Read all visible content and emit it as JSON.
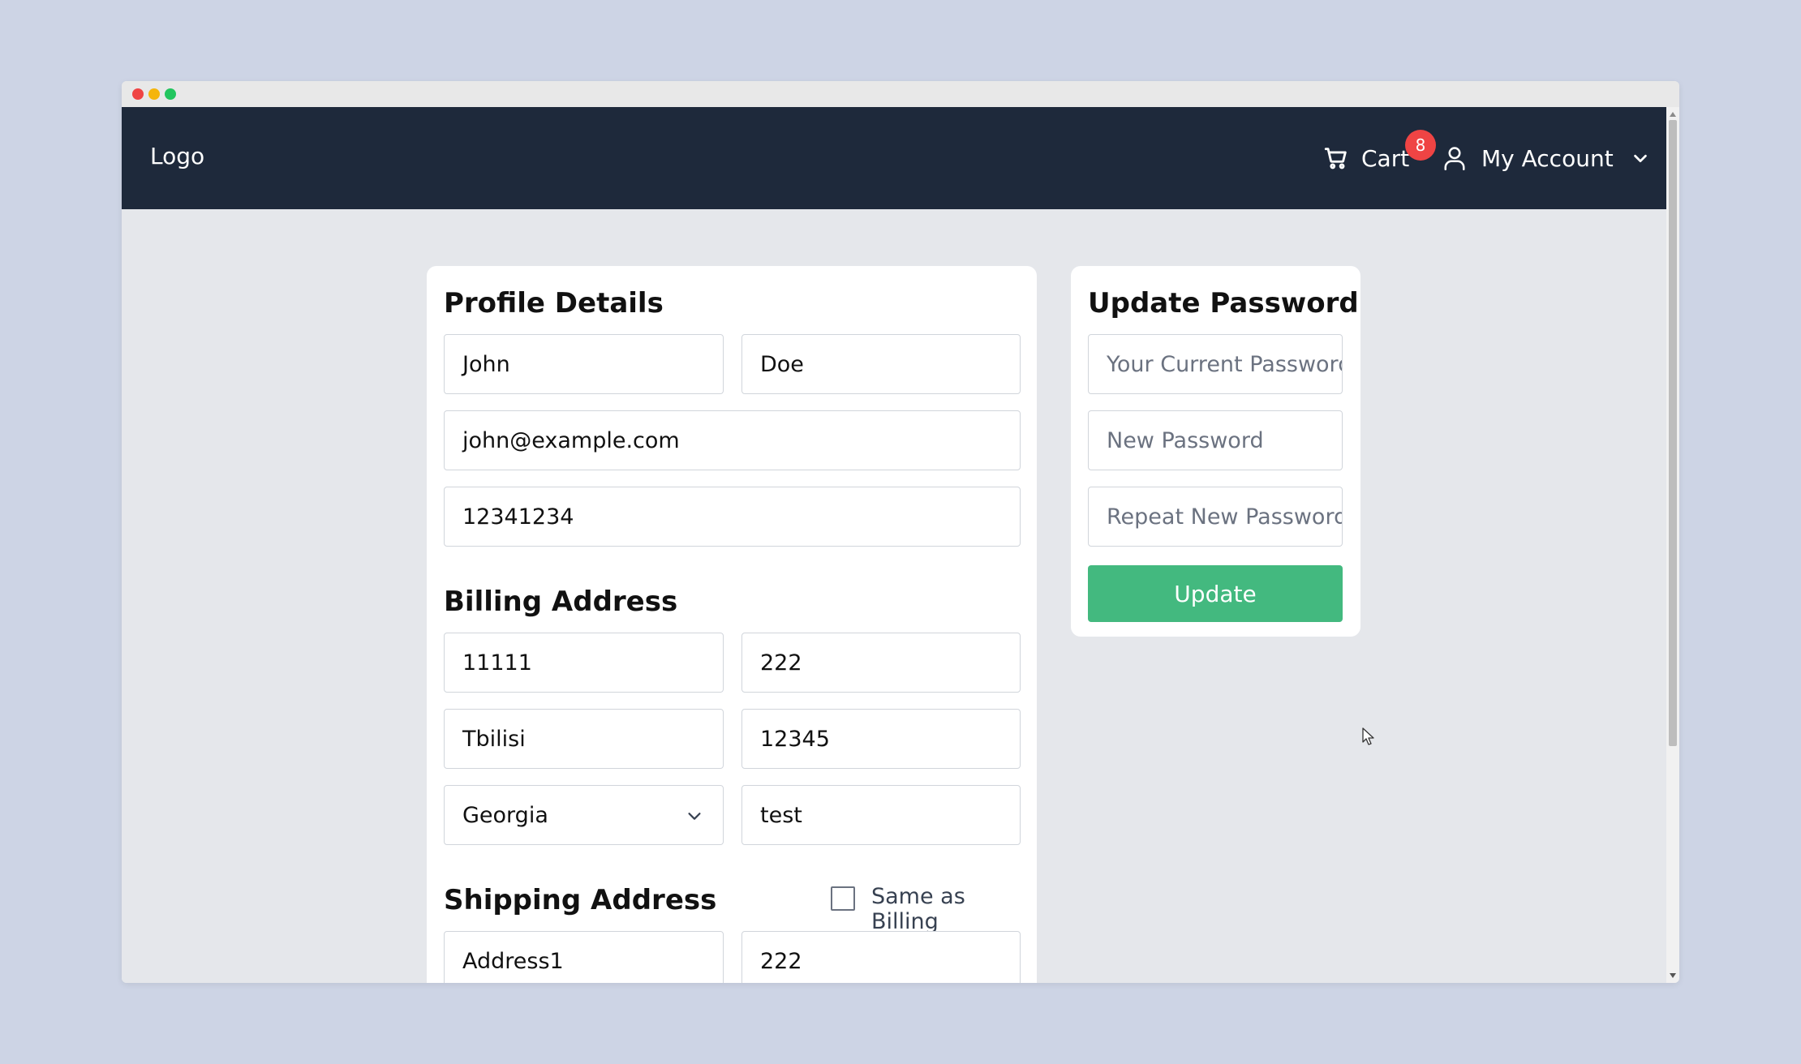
{
  "navbar": {
    "logo": "Logo",
    "cart_label": "Cart",
    "cart_count": "8",
    "account_label": "My Account"
  },
  "profile": {
    "title": "Profile Details",
    "first_name": "John",
    "last_name": "Doe",
    "email": "john@example.com",
    "phone": "12341234"
  },
  "billing": {
    "title": "Billing Address",
    "address": "11111",
    "number": "222",
    "city": "Tbilisi",
    "zip": "12345",
    "country": "Georgia",
    "extra": "test"
  },
  "shipping": {
    "title": "Shipping Address",
    "same_as_billing_label": "Same as Billing",
    "same_as_billing_checked": false,
    "address": "Address1",
    "number": "222"
  },
  "password": {
    "title": "Update Password",
    "current_placeholder": "Your Current Password",
    "new_placeholder": "New Password",
    "repeat_placeholder": "Repeat New Password",
    "update_label": "Update"
  },
  "colors": {
    "navbar": "#1e293b",
    "badge": "#ef4444",
    "button": "#43b97f",
    "page_bg": "#e5e7eb",
    "outer_bg": "#cdd4e5"
  },
  "icons": {
    "cart": "cart-icon",
    "user": "user-icon",
    "chevron": "chevron-down-icon"
  }
}
